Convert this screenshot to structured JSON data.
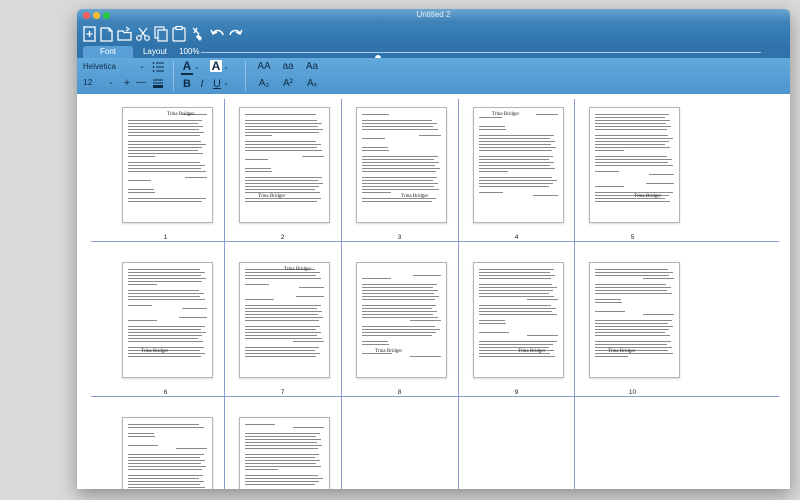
{
  "window": {
    "title": "Untitled 2"
  },
  "toolbar": {
    "icons": [
      "new-document-icon",
      "open-document-icon",
      "open-folder-icon",
      "cut-icon",
      "copy-icon",
      "paste-icon",
      "format-brush-icon",
      "undo-icon",
      "redo-icon"
    ]
  },
  "tabs": {
    "font": "Font",
    "layout": "Layout"
  },
  "zoom": {
    "label": "100%",
    "value": 0.31
  },
  "fontbar": {
    "font_name": "Helvetica",
    "font_size": "12",
    "minus": "—",
    "plus": "+",
    "bold": "B",
    "italic": "I",
    "underline": "U",
    "text_color": "A",
    "highlight": "A",
    "case_upper": "AA",
    "case_lower": "aa",
    "case_title": "Aa",
    "subscript": "A₂",
    "superscript": "A²",
    "clear_format": "Aₓ"
  },
  "pages": [
    {
      "number": "1"
    },
    {
      "number": "2"
    },
    {
      "number": "3"
    },
    {
      "number": "4"
    },
    {
      "number": "5"
    },
    {
      "number": "6"
    },
    {
      "number": "7"
    },
    {
      "number": "8"
    },
    {
      "number": "9"
    },
    {
      "number": "10"
    },
    {
      "number": ""
    },
    {
      "number": ""
    }
  ],
  "page_signature": "Trina Bridger"
}
